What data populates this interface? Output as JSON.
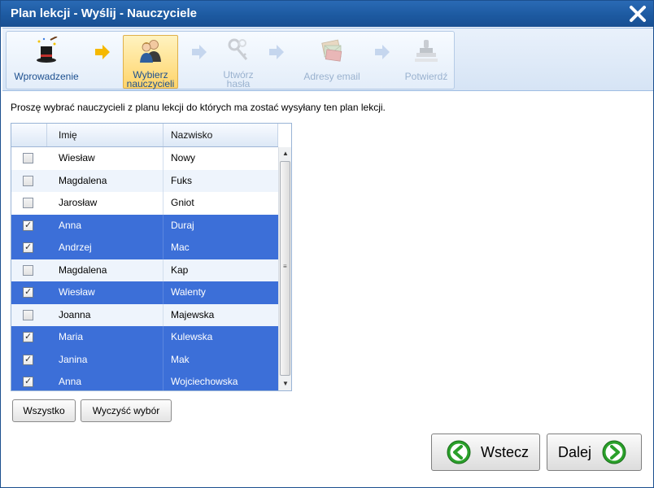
{
  "window": {
    "title": "Plan lekcji - Wyślij - Nauczyciele",
    "close_icon": "close-icon"
  },
  "wizard": {
    "steps": [
      {
        "label": "Wprowadzenie",
        "state": "done",
        "icon": "magic-hat-icon"
      },
      {
        "label_line1": "Wybierz",
        "label_line2": "nauczycieli",
        "state": "active",
        "icon": "teachers-icon"
      },
      {
        "label_line1": "Utwórz",
        "label_line2": "hasła",
        "state": "disabled",
        "icon": "keys-icon"
      },
      {
        "label": "Adresy email",
        "state": "disabled",
        "icon": "envelopes-icon"
      },
      {
        "label": "Potwierdź",
        "state": "disabled",
        "icon": "stamp-icon"
      }
    ],
    "colors": {
      "active_arrow": "#f5b800",
      "inactive_arrow": "#c5d6ee"
    }
  },
  "instruction": "Proszę wybrać nauczycieli z planu lekcji do których ma zostać wysyłany ten plan lekcji.",
  "grid": {
    "columns": [
      "Imię",
      "Nazwisko"
    ],
    "rows": [
      {
        "first": "Wiesław",
        "last": "Nowy",
        "checked": false
      },
      {
        "first": "Magdalena",
        "last": "Fuks",
        "checked": false
      },
      {
        "first": "Jarosław",
        "last": "Gniot",
        "checked": false
      },
      {
        "first": "Anna",
        "last": "Duraj",
        "checked": true
      },
      {
        "first": "Andrzej",
        "last": "Mac",
        "checked": true
      },
      {
        "first": "Magdalena",
        "last": "Kap",
        "checked": false
      },
      {
        "first": "Wiesław",
        "last": "Walenty",
        "checked": true
      },
      {
        "first": "Joanna",
        "last": "Majewska",
        "checked": false
      },
      {
        "first": "Maria",
        "last": "Kulewska",
        "checked": true
      },
      {
        "first": "Janina",
        "last": "Mak",
        "checked": true
      },
      {
        "first": "Anna",
        "last": "Wojciechowska",
        "checked": true
      }
    ],
    "selection_color": "#3c6fd8"
  },
  "buttons": {
    "select_all": "Wszystko",
    "clear_selection": "Wyczyść wybór",
    "back": "Wstecz",
    "next": "Dalej"
  }
}
